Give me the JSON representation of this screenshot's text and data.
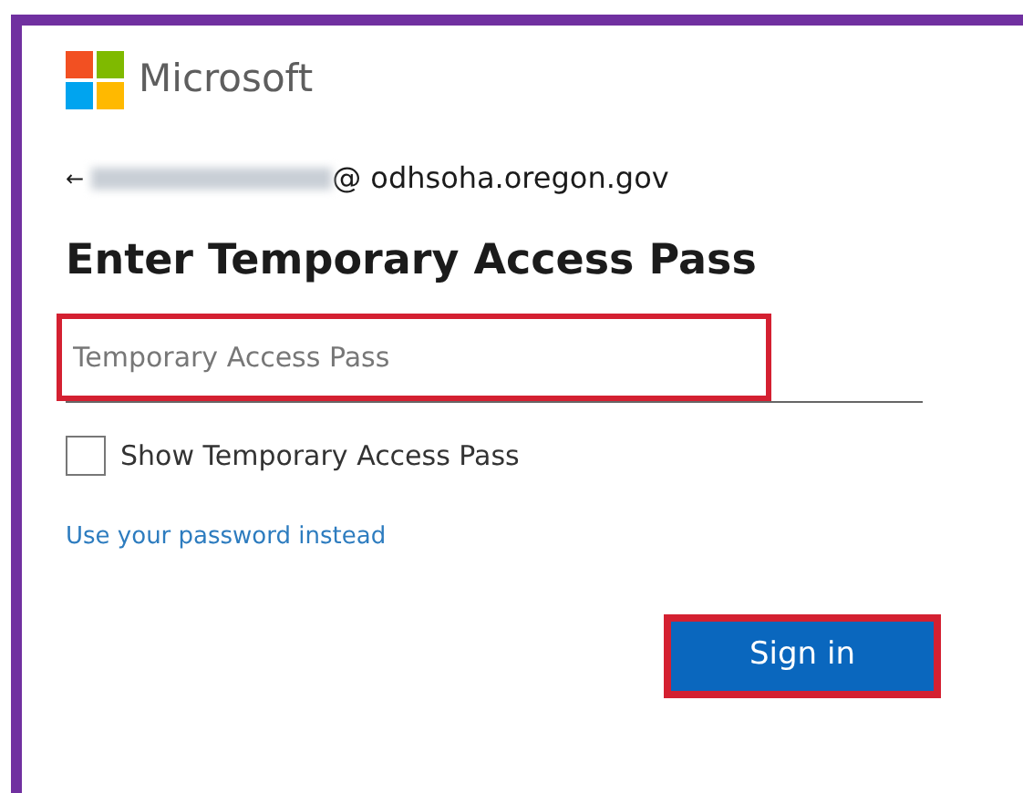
{
  "brand": {
    "name": "Microsoft"
  },
  "account": {
    "back": "←",
    "redacted": true,
    "domain": "@ odhsoha.oregon.gov"
  },
  "heading": "Enter Temporary Access Pass",
  "pass_field": {
    "placeholder": "Temporary Access Pass",
    "highlighted": true
  },
  "show_pass": {
    "label": "Show Temporary Access Pass",
    "checked": false
  },
  "alt_link": "Use your password instead",
  "sign_in": {
    "label": "Sign in",
    "highlighted": true
  }
}
